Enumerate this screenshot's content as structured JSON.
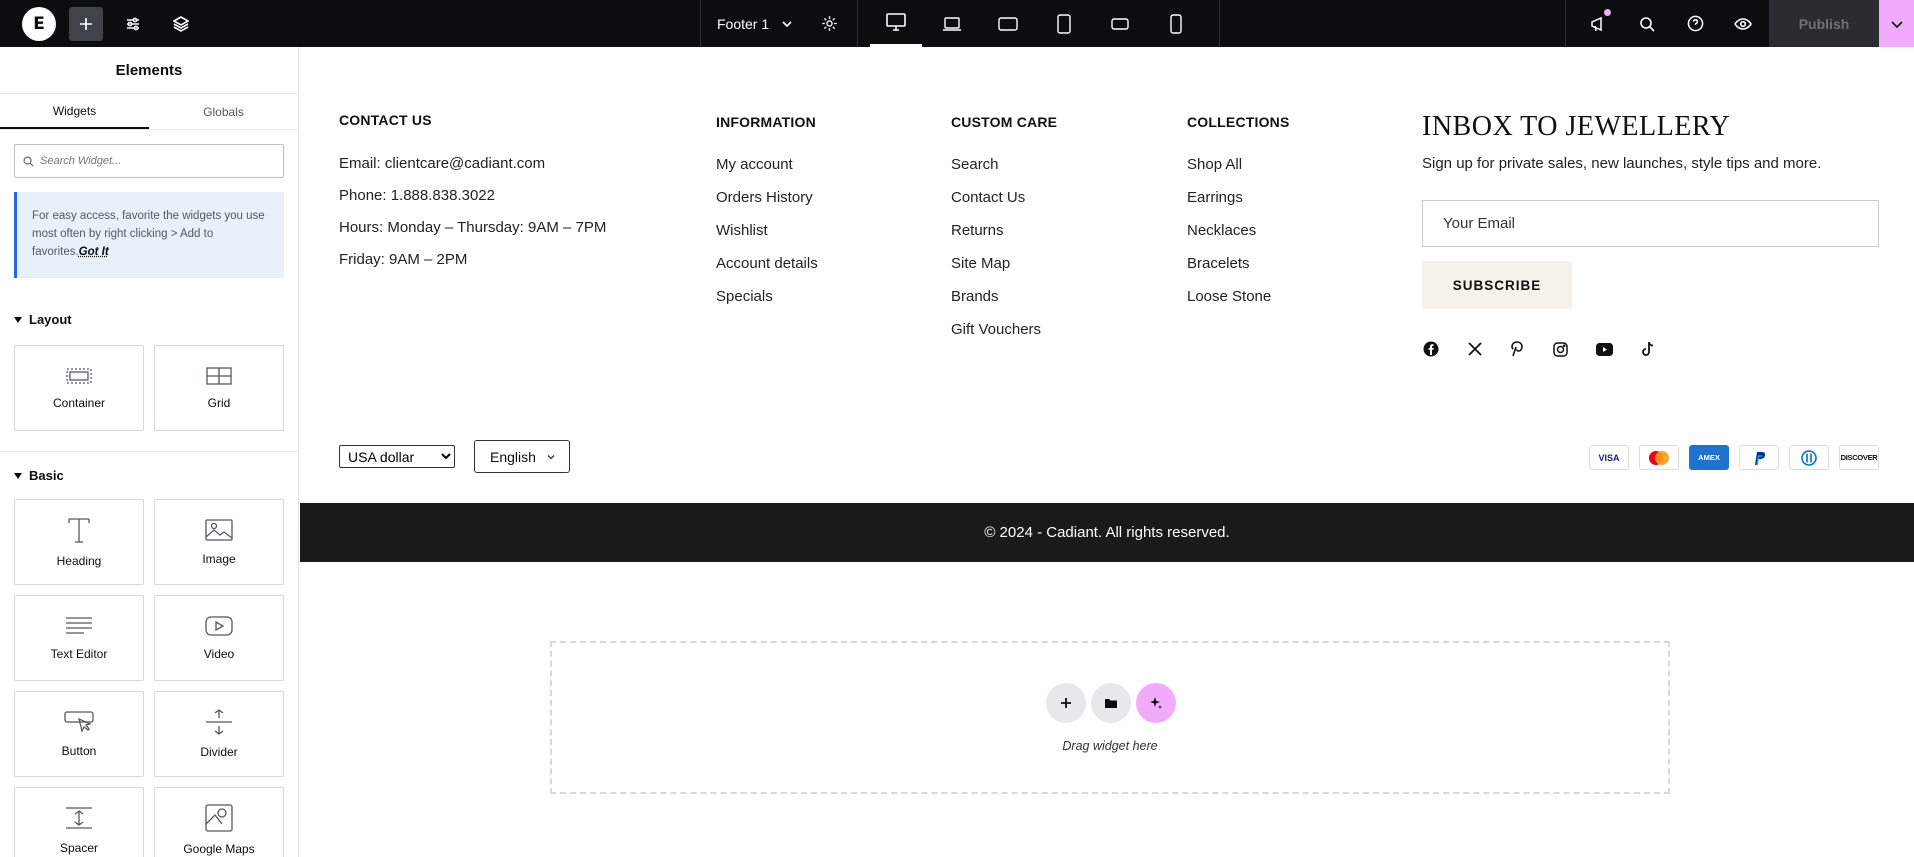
{
  "topbar": {
    "logo_letter": "E",
    "document_title": "Footer 1",
    "publish_label": "Publish",
    "accent_color": "#f0abfc"
  },
  "sidebar": {
    "title": "Elements",
    "tabs": [
      "Widgets",
      "Globals"
    ],
    "search_placeholder": "Search Widget...",
    "tip_text": "For easy access, favorite the widgets you use most often by right clicking > Add to favorites.",
    "tip_link": "Got It",
    "sections": {
      "layout": {
        "title": "Layout",
        "widgets": [
          "Container",
          "Grid"
        ]
      },
      "basic": {
        "title": "Basic",
        "widgets": [
          "Heading",
          "Image",
          "Text Editor",
          "Video",
          "Button",
          "Divider",
          "Spacer",
          "Google Maps"
        ]
      }
    }
  },
  "footer": {
    "contact": {
      "title": "CONTACT US",
      "lines": [
        "Email: clientcare@cadiant.com",
        "Phone: 1.888.838.3022",
        "Hours: Monday – Thursday: 9AM – 7PM",
        "Friday: 9AM – 2PM"
      ]
    },
    "information": {
      "title": "INFORMATION",
      "links": [
        "My account",
        "Orders History",
        "Wishlist",
        "Account details",
        "Specials"
      ]
    },
    "custom_care": {
      "title": "CUSTOM CARE",
      "links": [
        "Search",
        "Contact Us",
        "Returns",
        "Site Map",
        "Brands",
        "Gift Vouchers"
      ]
    },
    "collections": {
      "title": "COLLECTIONS",
      "links": [
        "Shop All",
        "Earrings",
        "Necklaces",
        "Bracelets",
        "Loose Stone"
      ]
    },
    "newsletter": {
      "title": "INBOX TO JEWELLERY",
      "subtitle": "Sign up for private sales, new launches, style tips and more.",
      "email_placeholder": "Your Email",
      "button": "SUBSCRIBE"
    },
    "social_icons": [
      "facebook-icon",
      "x-icon",
      "pinterest-icon",
      "instagram-icon",
      "youtube-icon",
      "tiktok-icon"
    ],
    "currency": "USA dollar",
    "language": "English",
    "payments": [
      "VISA",
      "Mastercard",
      "AMEX",
      "PayPal",
      "Diners",
      "DISCOVER"
    ],
    "copyright": "© 2024 - Cadiant. All rights reserved."
  },
  "dropzone": {
    "text": "Drag widget here"
  }
}
